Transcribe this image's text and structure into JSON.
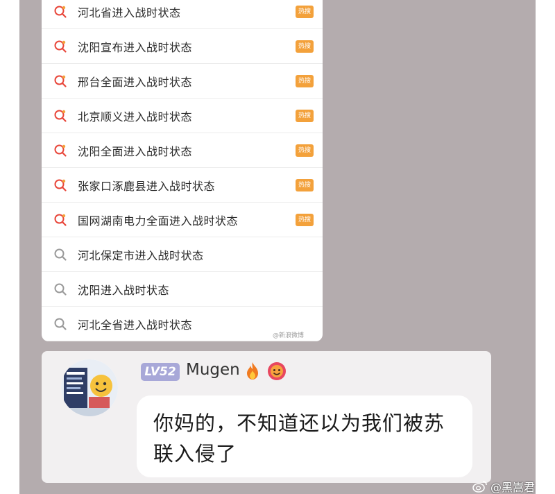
{
  "search_list": {
    "items": [
      {
        "text": "河北省进入战时状态",
        "hot": true
      },
      {
        "text": "沈阳宣布进入战时状态",
        "hot": true
      },
      {
        "text": "邢台全面进入战时状态",
        "hot": true
      },
      {
        "text": "北京顺义进入战时状态",
        "hot": true
      },
      {
        "text": "沈阳全面进入战时状态",
        "hot": true
      },
      {
        "text": "张家口涿鹿县进入战时状态",
        "hot": true
      },
      {
        "text": "国网湖南电力全面进入战时状态",
        "hot": true
      },
      {
        "text": "河北保定市进入战时状态",
        "hot": false
      },
      {
        "text": "沈阳进入战时状态",
        "hot": false
      },
      {
        "text": "河北全省进入战时状态",
        "hot": false
      }
    ],
    "hot_badge_label": "热搜",
    "watermark": "@新浪微博"
  },
  "chat": {
    "level": "LV52",
    "username": "Mugen",
    "message": "你妈的，不知道还以为我们被苏联入侵了",
    "icons": [
      "flame-icon",
      "emblem-icon"
    ]
  },
  "page_watermark": "@黑嵩君",
  "colors": {
    "frame_bg": "#b4acae",
    "hot_badge": "#f3a13b",
    "level_badge": "#a8a8d8",
    "search_icon_hot": "#e8463a",
    "search_icon_normal": "#9a9a9a"
  }
}
